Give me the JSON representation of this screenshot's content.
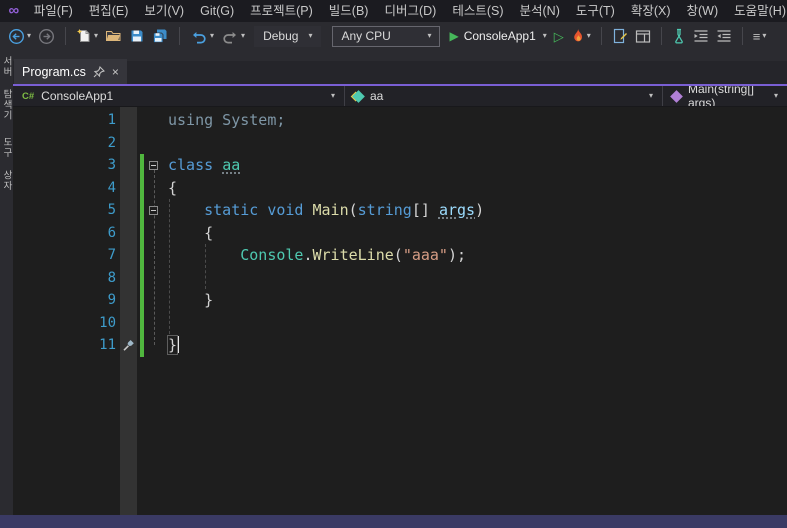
{
  "title_bar": {
    "menus": [
      "파일(F)",
      "편집(E)",
      "보기(V)",
      "Git(G)",
      "프로젝트(P)",
      "빌드(B)",
      "디버그(D)",
      "테스트(S)",
      "분석(N)",
      "도구(T)",
      "확장(X)",
      "창(W)",
      "도움말(H)"
    ]
  },
  "toolbar": {
    "debug_config": "Debug",
    "platform": "Any CPU",
    "run_target": "ConsoleApp1"
  },
  "tab_bar": {
    "active_label": "Program.cs"
  },
  "navbar": {
    "project": "ConsoleApp1",
    "type": "aa",
    "member": "Main(string[] args)"
  },
  "side_tabs": [
    {
      "name": "server-explorer",
      "label": "서버 탐색기"
    },
    {
      "name": "toolbox",
      "label": "도구 상자"
    }
  ],
  "icons": {
    "logo": "∞",
    "caret": "▾",
    "play": "▶",
    "play_outline": "▷",
    "close": "×",
    "menu_grip": "≡",
    "project_badge": "C#"
  },
  "colors": {
    "accent_purple": "#7A5FD4",
    "change_green": "#50B63E",
    "status_bar": "#3A3A64",
    "editor_bg": "#1E1E1E"
  },
  "editor": {
    "token_colors": {
      "keyword": "#569CD6",
      "type": "#4EC9B0",
      "method": "#DCDCAA",
      "string": "#D69D85",
      "plain": "#D4D4D4",
      "param": "#9CDCFE",
      "faded": "#7E96A6"
    },
    "lines": [
      {
        "n": 1,
        "chg": false,
        "tokens": [
          {
            "t": "using System;",
            "c": "faded"
          }
        ]
      },
      {
        "n": 2,
        "chg": false,
        "tokens": []
      },
      {
        "n": 3,
        "chg": true,
        "fold": true,
        "tokens": [
          {
            "t": "class",
            "c": "keyword"
          },
          {
            "t": " ",
            "c": "plain"
          },
          {
            "t": "aa",
            "c": "type",
            "u": true
          }
        ]
      },
      {
        "n": 4,
        "chg": true,
        "tokens": [
          {
            "t": "{",
            "c": "plain"
          }
        ]
      },
      {
        "n": 5,
        "chg": true,
        "fold": true,
        "tokens": [
          {
            "t": "    ",
            "c": "plain"
          },
          {
            "t": "static",
            "c": "keyword"
          },
          {
            "t": " ",
            "c": "plain"
          },
          {
            "t": "void",
            "c": "keyword"
          },
          {
            "t": " ",
            "c": "plain"
          },
          {
            "t": "Main",
            "c": "method"
          },
          {
            "t": "(",
            "c": "plain"
          },
          {
            "t": "string",
            "c": "keyword"
          },
          {
            "t": "[] ",
            "c": "plain"
          },
          {
            "t": "args",
            "c": "param",
            "u": true
          },
          {
            "t": ")",
            "c": "plain"
          }
        ]
      },
      {
        "n": 6,
        "chg": true,
        "tokens": [
          {
            "t": "    {",
            "c": "plain"
          }
        ]
      },
      {
        "n": 7,
        "chg": true,
        "tokens": [
          {
            "t": "        ",
            "c": "plain"
          },
          {
            "t": "Console",
            "c": "type"
          },
          {
            "t": ".",
            "c": "plain"
          },
          {
            "t": "WriteLine",
            "c": "method"
          },
          {
            "t": "(",
            "c": "plain"
          },
          {
            "t": "\"aaa\"",
            "c": "string"
          },
          {
            "t": ")",
            "c": "plain"
          },
          {
            "t": ";",
            "c": "plain"
          }
        ]
      },
      {
        "n": 8,
        "chg": true,
        "tokens": []
      },
      {
        "n": 9,
        "chg": true,
        "tokens": [
          {
            "t": "    }",
            "c": "plain"
          }
        ]
      },
      {
        "n": 10,
        "chg": true,
        "tokens": []
      },
      {
        "n": 11,
        "chg": true,
        "glyph": "screwdriver",
        "caret": true,
        "tokens": [
          {
            "t": "}",
            "c": "plain",
            "box": true
          }
        ]
      }
    ]
  }
}
